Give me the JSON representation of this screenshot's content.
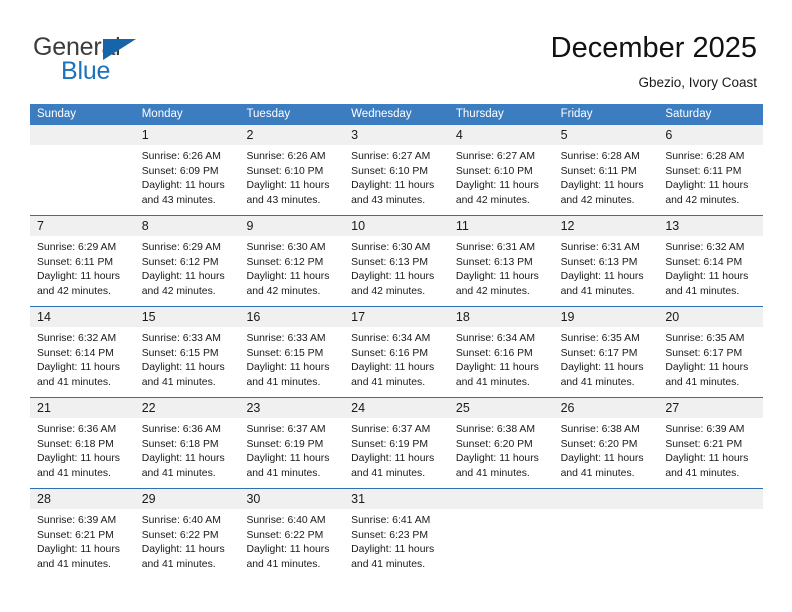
{
  "brand": {
    "name_top": "General",
    "name_bottom": "Blue",
    "triangle_color": "#1565a8",
    "blue_color": "#1c72bc"
  },
  "header": {
    "title": "December 2025",
    "subtitle": "Gbezio, Ivory Coast"
  },
  "theme": {
    "header_band": "#3b7dc0",
    "row_divider": "#2f6fb5",
    "day_band": "#f0f0f0"
  },
  "weekdays": [
    "Sunday",
    "Monday",
    "Tuesday",
    "Wednesday",
    "Thursday",
    "Friday",
    "Saturday"
  ],
  "weeks": [
    [
      {
        "day": "",
        "lines": []
      },
      {
        "day": "1",
        "lines": [
          "Sunrise: 6:26 AM",
          "Sunset: 6:09 PM",
          "Daylight: 11 hours",
          "and 43 minutes."
        ]
      },
      {
        "day": "2",
        "lines": [
          "Sunrise: 6:26 AM",
          "Sunset: 6:10 PM",
          "Daylight: 11 hours",
          "and 43 minutes."
        ]
      },
      {
        "day": "3",
        "lines": [
          "Sunrise: 6:27 AM",
          "Sunset: 6:10 PM",
          "Daylight: 11 hours",
          "and 43 minutes."
        ]
      },
      {
        "day": "4",
        "lines": [
          "Sunrise: 6:27 AM",
          "Sunset: 6:10 PM",
          "Daylight: 11 hours",
          "and 42 minutes."
        ]
      },
      {
        "day": "5",
        "lines": [
          "Sunrise: 6:28 AM",
          "Sunset: 6:11 PM",
          "Daylight: 11 hours",
          "and 42 minutes."
        ]
      },
      {
        "day": "6",
        "lines": [
          "Sunrise: 6:28 AM",
          "Sunset: 6:11 PM",
          "Daylight: 11 hours",
          "and 42 minutes."
        ]
      }
    ],
    [
      {
        "day": "7",
        "lines": [
          "Sunrise: 6:29 AM",
          "Sunset: 6:11 PM",
          "Daylight: 11 hours",
          "and 42 minutes."
        ]
      },
      {
        "day": "8",
        "lines": [
          "Sunrise: 6:29 AM",
          "Sunset: 6:12 PM",
          "Daylight: 11 hours",
          "and 42 minutes."
        ]
      },
      {
        "day": "9",
        "lines": [
          "Sunrise: 6:30 AM",
          "Sunset: 6:12 PM",
          "Daylight: 11 hours",
          "and 42 minutes."
        ]
      },
      {
        "day": "10",
        "lines": [
          "Sunrise: 6:30 AM",
          "Sunset: 6:13 PM",
          "Daylight: 11 hours",
          "and 42 minutes."
        ]
      },
      {
        "day": "11",
        "lines": [
          "Sunrise: 6:31 AM",
          "Sunset: 6:13 PM",
          "Daylight: 11 hours",
          "and 42 minutes."
        ]
      },
      {
        "day": "12",
        "lines": [
          "Sunrise: 6:31 AM",
          "Sunset: 6:13 PM",
          "Daylight: 11 hours",
          "and 41 minutes."
        ]
      },
      {
        "day": "13",
        "lines": [
          "Sunrise: 6:32 AM",
          "Sunset: 6:14 PM",
          "Daylight: 11 hours",
          "and 41 minutes."
        ]
      }
    ],
    [
      {
        "day": "14",
        "lines": [
          "Sunrise: 6:32 AM",
          "Sunset: 6:14 PM",
          "Daylight: 11 hours",
          "and 41 minutes."
        ]
      },
      {
        "day": "15",
        "lines": [
          "Sunrise: 6:33 AM",
          "Sunset: 6:15 PM",
          "Daylight: 11 hours",
          "and 41 minutes."
        ]
      },
      {
        "day": "16",
        "lines": [
          "Sunrise: 6:33 AM",
          "Sunset: 6:15 PM",
          "Daylight: 11 hours",
          "and 41 minutes."
        ]
      },
      {
        "day": "17",
        "lines": [
          "Sunrise: 6:34 AM",
          "Sunset: 6:16 PM",
          "Daylight: 11 hours",
          "and 41 minutes."
        ]
      },
      {
        "day": "18",
        "lines": [
          "Sunrise: 6:34 AM",
          "Sunset: 6:16 PM",
          "Daylight: 11 hours",
          "and 41 minutes."
        ]
      },
      {
        "day": "19",
        "lines": [
          "Sunrise: 6:35 AM",
          "Sunset: 6:17 PM",
          "Daylight: 11 hours",
          "and 41 minutes."
        ]
      },
      {
        "day": "20",
        "lines": [
          "Sunrise: 6:35 AM",
          "Sunset: 6:17 PM",
          "Daylight: 11 hours",
          "and 41 minutes."
        ]
      }
    ],
    [
      {
        "day": "21",
        "lines": [
          "Sunrise: 6:36 AM",
          "Sunset: 6:18 PM",
          "Daylight: 11 hours",
          "and 41 minutes."
        ]
      },
      {
        "day": "22",
        "lines": [
          "Sunrise: 6:36 AM",
          "Sunset: 6:18 PM",
          "Daylight: 11 hours",
          "and 41 minutes."
        ]
      },
      {
        "day": "23",
        "lines": [
          "Sunrise: 6:37 AM",
          "Sunset: 6:19 PM",
          "Daylight: 11 hours",
          "and 41 minutes."
        ]
      },
      {
        "day": "24",
        "lines": [
          "Sunrise: 6:37 AM",
          "Sunset: 6:19 PM",
          "Daylight: 11 hours",
          "and 41 minutes."
        ]
      },
      {
        "day": "25",
        "lines": [
          "Sunrise: 6:38 AM",
          "Sunset: 6:20 PM",
          "Daylight: 11 hours",
          "and 41 minutes."
        ]
      },
      {
        "day": "26",
        "lines": [
          "Sunrise: 6:38 AM",
          "Sunset: 6:20 PM",
          "Daylight: 11 hours",
          "and 41 minutes."
        ]
      },
      {
        "day": "27",
        "lines": [
          "Sunrise: 6:39 AM",
          "Sunset: 6:21 PM",
          "Daylight: 11 hours",
          "and 41 minutes."
        ]
      }
    ],
    [
      {
        "day": "28",
        "lines": [
          "Sunrise: 6:39 AM",
          "Sunset: 6:21 PM",
          "Daylight: 11 hours",
          "and 41 minutes."
        ]
      },
      {
        "day": "29",
        "lines": [
          "Sunrise: 6:40 AM",
          "Sunset: 6:22 PM",
          "Daylight: 11 hours",
          "and 41 minutes."
        ]
      },
      {
        "day": "30",
        "lines": [
          "Sunrise: 6:40 AM",
          "Sunset: 6:22 PM",
          "Daylight: 11 hours",
          "and 41 minutes."
        ]
      },
      {
        "day": "31",
        "lines": [
          "Sunrise: 6:41 AM",
          "Sunset: 6:23 PM",
          "Daylight: 11 hours",
          "and 41 minutes."
        ]
      },
      {
        "day": "",
        "lines": []
      },
      {
        "day": "",
        "lines": []
      },
      {
        "day": "",
        "lines": []
      }
    ]
  ]
}
